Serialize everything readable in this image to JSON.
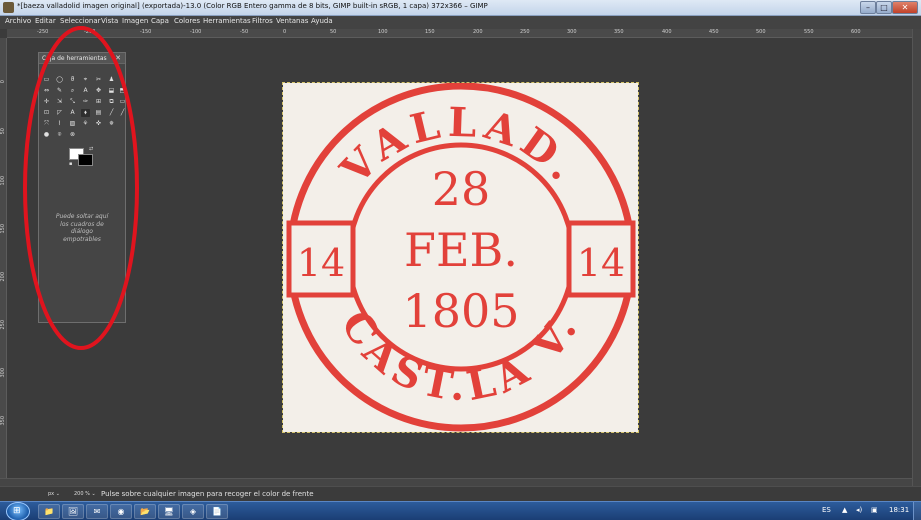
{
  "window": {
    "title": "*[baeza valladolid imagen original] (exportada)-13.0 (Color RGB Entero gamma de 8 bits, GIMP built-in sRGB, 1 capa) 372x366 – GIMP",
    "min_label": "–",
    "max_label": "□",
    "close_label": "✕"
  },
  "menu": [
    "Archivo",
    "Editar",
    "Seleccionar",
    "Vista",
    "Imagen",
    "Capa",
    "Colores",
    "Herramientas",
    "Filtros",
    "Ventanas",
    "Ayuda"
  ],
  "ruler": {
    "top_labels": [
      "-250",
      "-200",
      "-150",
      "-100",
      "-50",
      "0",
      "50",
      "100",
      "150",
      "200",
      "250",
      "300",
      "350",
      "400",
      "450",
      "500",
      "550",
      "600"
    ],
    "left_labels": [
      "0",
      "50",
      "100",
      "150",
      "200",
      "250",
      "300",
      "350"
    ]
  },
  "toolbox": {
    "title": "Caja de herramientas",
    "close_label": "✕",
    "drop_hint": "Puede soltar aquí los cuadros de diálogo empotrables",
    "swap_icon": "swap-colors-icon",
    "default_icon": "default-colors-icon",
    "tools": [
      "▭",
      "◯",
      "ϑ",
      "⌖",
      "✂",
      "♟",
      "⇔",
      "✎",
      "⌕",
      "A",
      "✥",
      "⬓",
      "⬒",
      "✢",
      "⇲",
      "⤡",
      "✑",
      "⊞",
      "⧉",
      "▭",
      "⊡",
      "◸",
      "A",
      "⬧",
      "▤",
      "╱",
      "╱",
      "⤧",
      "⌇",
      "▨",
      "⚘",
      "✜",
      "✵",
      "●",
      "⌾",
      "⊗"
    ]
  },
  "image": {
    "stamp_color": "#e2413a",
    "background": "#f3efe9",
    "text_top": "VALLAD.",
    "text_top_superscript": "D",
    "day": "28",
    "month": "FEB.",
    "year": "1805",
    "left_number": "14",
    "right_number": "14",
    "text_bottom": "CAST.LA V."
  },
  "status": {
    "unit": "px",
    "zoom": "200 %",
    "message": "Pulse sobre cualquier imagen para recoger el color de frente"
  },
  "taskbar": {
    "start_label": "⊞",
    "apps": [
      "📁",
      "🖼",
      "✉",
      "◉",
      "📂",
      "🖥",
      "◈",
      "📄",
      "🦊"
    ],
    "lang": "ES",
    "clock": "18:31"
  },
  "annotation_color": "#e0141e"
}
